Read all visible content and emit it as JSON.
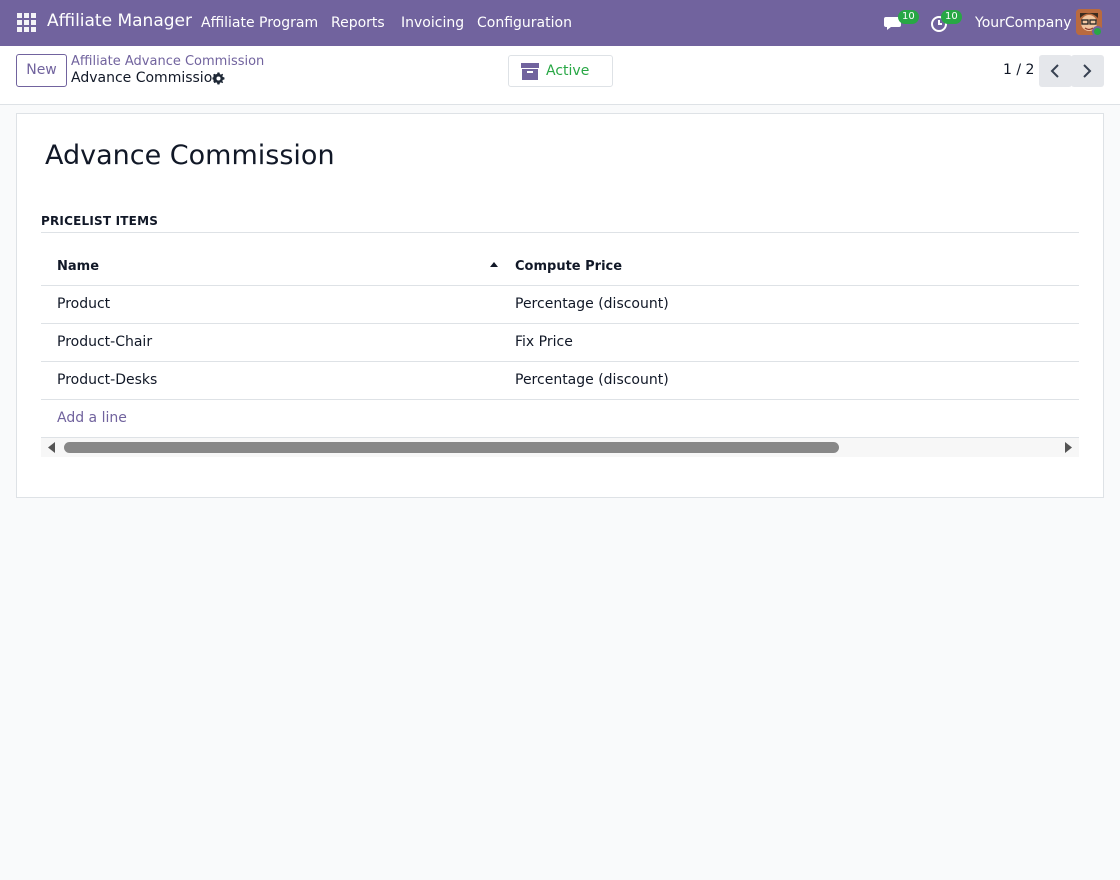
{
  "navbar": {
    "brand": "Affiliate Manager",
    "menu": [
      "Affiliate Program",
      "Reports",
      "Invoicing",
      "Configuration"
    ],
    "messages_badge": "10",
    "activities_badge": "10",
    "company": "YourCompany"
  },
  "control_panel": {
    "new_label": "New",
    "breadcrumb_parent": "Affiliate Advance Commission",
    "breadcrumb_current": "Advance Commission",
    "status_label": "Active",
    "pager": "1 / 2"
  },
  "form": {
    "title": "Advance Commission",
    "section_title": "PRICELIST ITEMS",
    "columns": [
      "Name",
      "Compute Price"
    ],
    "rows": [
      {
        "name": "Product",
        "compute_price": "Percentage (discount)"
      },
      {
        "name": "Product-Chair",
        "compute_price": "Fix Price"
      },
      {
        "name": "Product-Desks",
        "compute_price": "Percentage (discount)"
      }
    ],
    "add_line_label": "Add a line"
  },
  "colors": {
    "brand": "#71639e",
    "status_active": "#28a745",
    "badge": "#28a745"
  },
  "icons": {
    "apps": "apps-grid-icon",
    "messages": "chat-icon",
    "activities": "clock-icon",
    "gear": "gear-icon",
    "archive": "archive-icon",
    "prev": "chevron-left-icon",
    "next": "chevron-right-icon",
    "sort": "sort-ascending-icon"
  }
}
